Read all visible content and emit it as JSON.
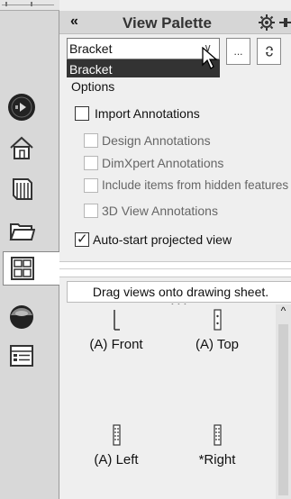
{
  "header": {
    "collapse_label": "«",
    "title": "View Palette"
  },
  "document_select": {
    "value": "Bracket",
    "dropdown_option": "Bracket",
    "more_label": "...",
    "refresh_icon": "refresh-icon"
  },
  "options": {
    "title": "Options",
    "import_annotations": {
      "label": "Import Annotations",
      "checked": false
    },
    "design_annotations": {
      "label": "Design Annotations",
      "checked": false,
      "disabled": true
    },
    "dimxpert_annotations": {
      "label": "DimXpert Annotations",
      "checked": false,
      "disabled": true
    },
    "hidden_features": {
      "label": "Include items from hidden features",
      "checked": false,
      "disabled": true
    },
    "view_3d_annotations": {
      "label": "3D View Annotations",
      "checked": false,
      "disabled": true
    },
    "auto_start": {
      "label": "Auto-start projected view",
      "checked": true
    }
  },
  "palette": {
    "hint": "Drag views onto drawing sheet.",
    "views": [
      {
        "name": "(A) Front"
      },
      {
        "name": "(A) Top"
      },
      {
        "name": "(A) Left"
      },
      {
        "name": "*Right"
      }
    ]
  },
  "side_tabs": [
    "solidworks-resources-icon",
    "home-icon",
    "design-library-icon",
    "file-explorer-icon",
    "view-palette-icon",
    "appearances-icon",
    "custom-properties-icon"
  ]
}
